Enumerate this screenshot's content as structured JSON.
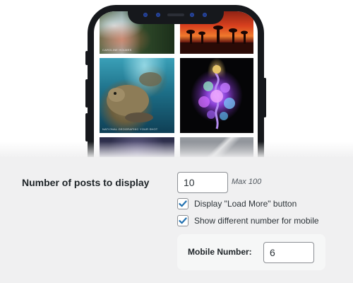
{
  "preview": {
    "captions": {
      "waterfall": "CAROLINE HOLMES",
      "turtle": "NATIONAL GEOGRAPHIC YOUR SHOT"
    }
  },
  "settings": {
    "posts_label": "Number of posts to display",
    "posts_value": "10",
    "posts_hint": "Max 100",
    "load_more": {
      "label": "Display \"Load More\" button",
      "checked": true
    },
    "different_mobile": {
      "label": "Show different number for mobile",
      "checked": true
    },
    "mobile_number_label": "Mobile Number:",
    "mobile_number_value": "6"
  },
  "colors": {
    "accent": "#2271b1",
    "panel_bg": "#f0f0f1",
    "phone_frame": "#16181c"
  }
}
